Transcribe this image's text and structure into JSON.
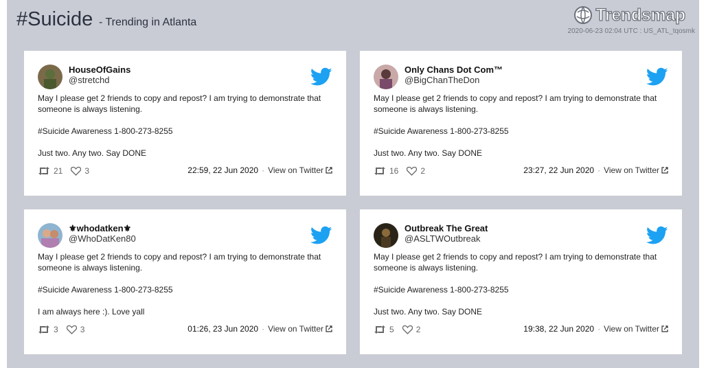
{
  "header": {
    "title": "#Suicide",
    "subtitle": "- Trending in Atlanta",
    "brand": "Trendsmap",
    "meta": "2020-06-23 02:04 UTC : US_ATL_tqosmk"
  },
  "colors": {
    "twitter_blue": "#1da1f2",
    "background": "#c9ccd4"
  },
  "tweets": [
    {
      "name": "HouseOfGains",
      "handle": "@stretchd",
      "lines": [
        "May I please get 2 friends to copy and repost? I am trying to demonstrate that someone is always listening.",
        "#Suicide Awareness 1-800-273-8255",
        "Just two. Any two. Say DONE"
      ],
      "retweets": "21",
      "likes": "3",
      "timestamp": "22:59, 22 Jun 2020",
      "link": "View on Twitter"
    },
    {
      "name": "Only Chans Dot Com™",
      "handle": "@BigChanTheDon",
      "lines": [
        "May I please get 2 friends to copy and repost? I am trying to demonstrate that someone is always listening.",
        "#Suicide Awareness 1-800-273-8255",
        "Just two. Any two. Say DONE"
      ],
      "retweets": "16",
      "likes": "2",
      "timestamp": "23:27, 22 Jun 2020",
      "link": "View on Twitter"
    },
    {
      "name": "⚜whodatken⚜",
      "handle": "@WhoDatKen80",
      "lines": [
        "May I please get 2 friends to copy and repost? I am trying to demonstrate that someone is always listening.",
        "#Suicide Awareness 1-800-273-8255",
        "I am always here :). Love yall"
      ],
      "retweets": "3",
      "likes": "3",
      "timestamp": "01:26, 23 Jun 2020",
      "link": "View on Twitter"
    },
    {
      "name": "Outbreak The Great",
      "handle": "@ASLTWOutbreak",
      "lines": [
        "May I please get 2 friends to copy and repost? I am trying to demonstrate that someone is always listening.",
        "#Suicide Awareness 1-800-273-8255",
        "Just two. Any two. Say DONE"
      ],
      "retweets": "5",
      "likes": "2",
      "timestamp": "19:38, 22 Jun 2020",
      "link": "View on Twitter"
    }
  ]
}
